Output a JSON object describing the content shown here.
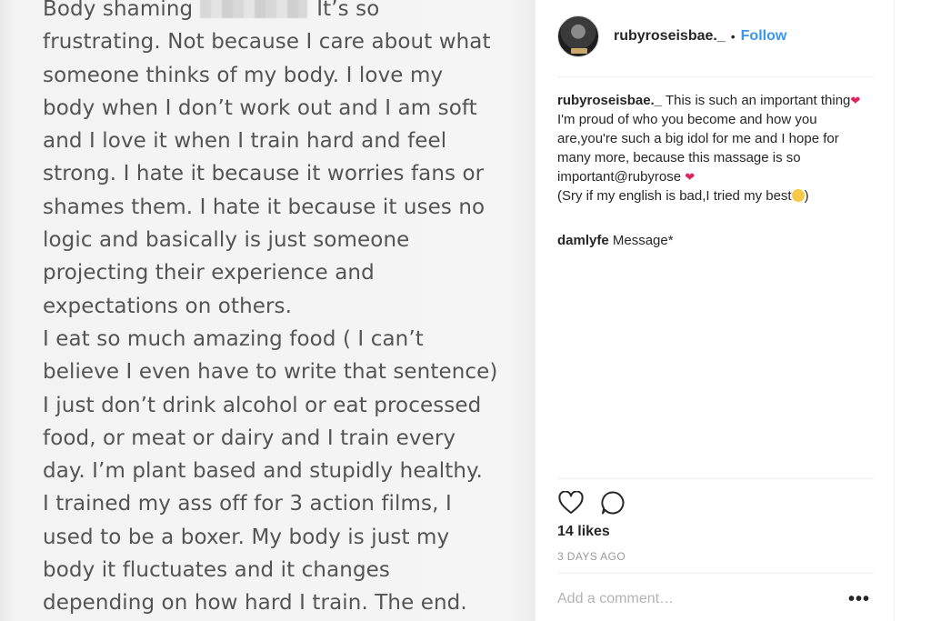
{
  "photo": {
    "lines": [
      {
        "before": "Body shaming",
        "after": "It’s so"
      },
      {
        "text": "frustrating. Not because I care about what"
      },
      {
        "text": "someone thinks of my body. I love my"
      },
      {
        "text": "body when I don’t work out and I am soft"
      },
      {
        "text": "and I love it when I train hard and feel"
      },
      {
        "text": "strong. I hate it because it worries fans or"
      },
      {
        "text": "shames them. I hate it because it uses no"
      },
      {
        "text": "logic and basically is just someone"
      },
      {
        "text": "projecting their experience and"
      },
      {
        "text": "expectations on others."
      },
      {
        "text": "I eat so much amazing food ( I can’t"
      },
      {
        "text": "believe I even have to write that sentence)"
      },
      {
        "text": "I just don’t drink alcohol or eat processed"
      },
      {
        "text": "food, or meat or dairy and I train every"
      },
      {
        "text": "day. I’m plant based and stupidly healthy."
      },
      {
        "text": "I trained my ass off for 3 action films, I"
      },
      {
        "text": "used to be a boxer. My body is just my"
      },
      {
        "text": "body it fluctuates and it changes"
      },
      {
        "text": "depending on how hard I train. The end."
      }
    ]
  },
  "header": {
    "username": "rubyroseisbae._",
    "separator": "•",
    "follow_label": "Follow"
  },
  "caption": {
    "username": "rubyroseisbae._",
    "part1": " This is such an important thing",
    "part2": " I'm proud of who you become and how you are,you're such a big idol for me and I hope for many more, because this massage is so important@rubyrose ",
    "part3": "(Sry if my english is bad,I tried my best",
    "part4": ")"
  },
  "comment": {
    "username": "damlyfe",
    "text": " Message*"
  },
  "engagement": {
    "likes": "14 likes",
    "timestamp": "3 DAYS AGO"
  },
  "add_comment": {
    "placeholder": "Add a comment…",
    "more_label": "•••"
  },
  "colors": {
    "accent": "#3897f0",
    "text": "#262626",
    "muted": "#999999",
    "heart": "#e0245e"
  },
  "icons": [
    "heart-icon",
    "comment-bubble-icon",
    "more-options-icon"
  ]
}
